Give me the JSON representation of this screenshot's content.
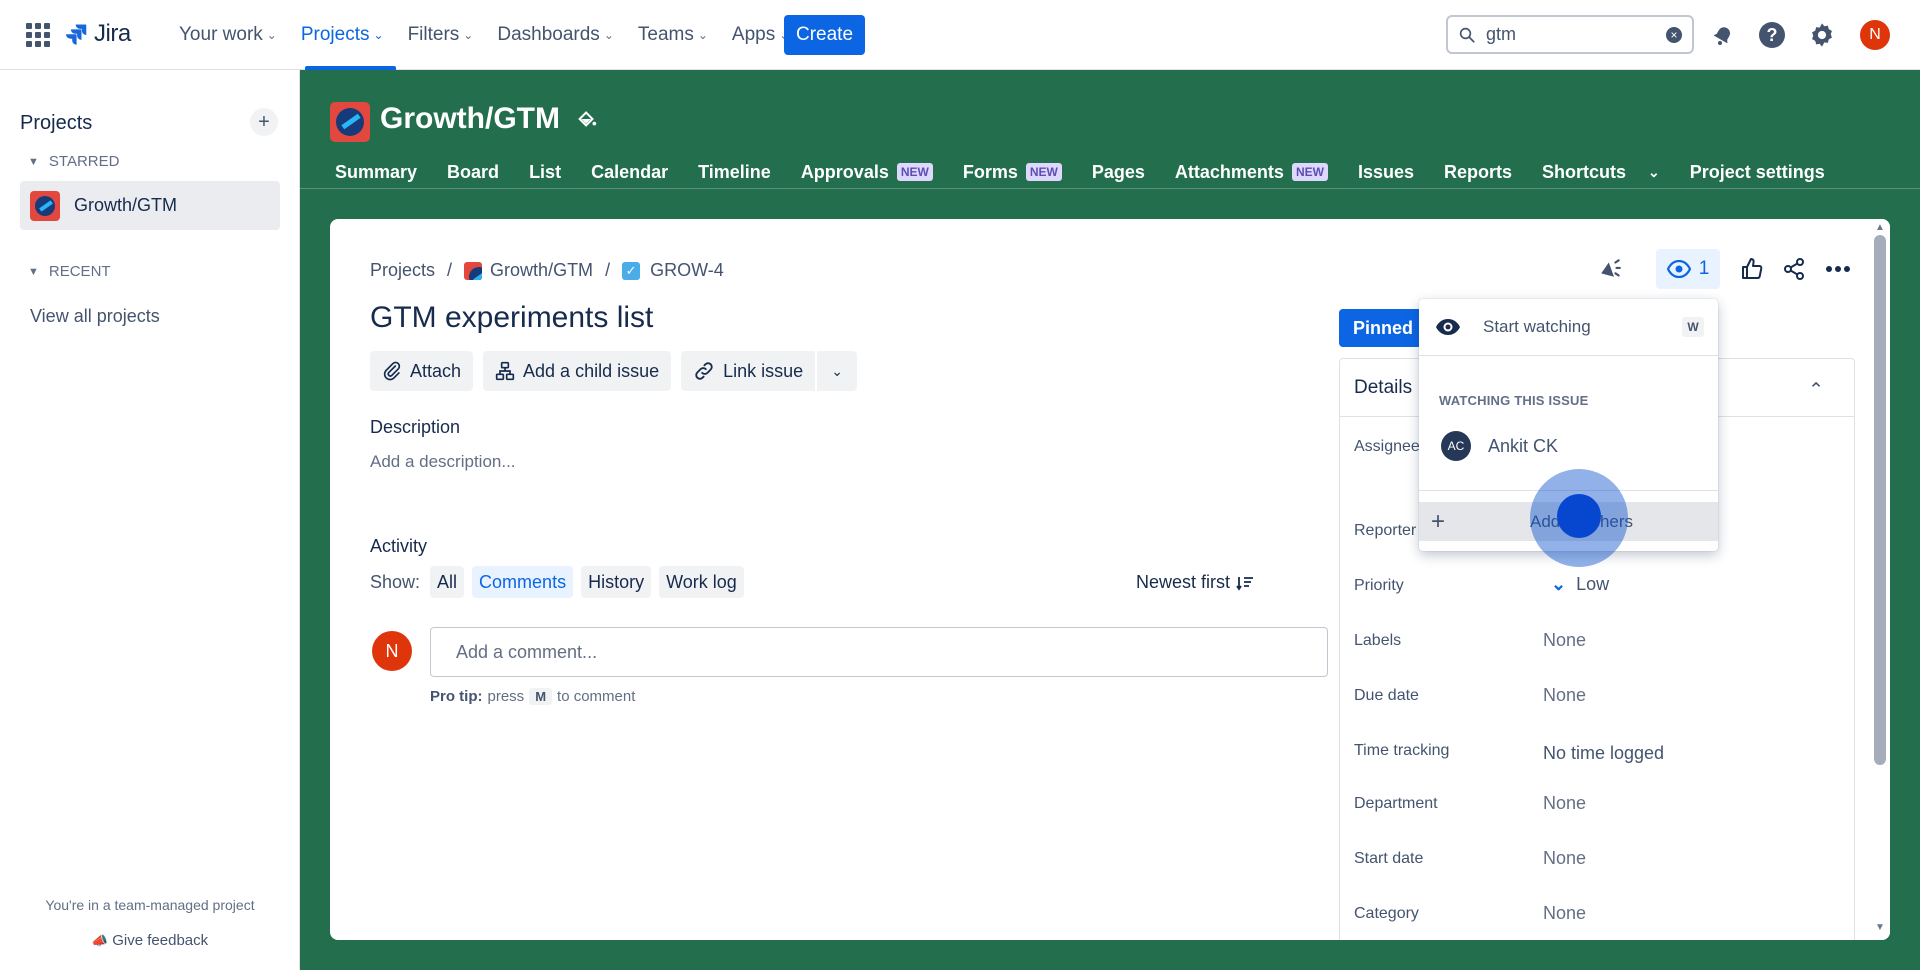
{
  "topnav": {
    "logo_text": "Jira",
    "items": [
      {
        "label": "Your work"
      },
      {
        "label": "Projects"
      },
      {
        "label": "Filters"
      },
      {
        "label": "Dashboards"
      },
      {
        "label": "Teams"
      },
      {
        "label": "Apps"
      }
    ],
    "active_item": "Projects",
    "create_label": "Create",
    "search_value": "gtm",
    "avatar_initial": "N"
  },
  "sidebar": {
    "title": "Projects",
    "starred_label": "STARRED",
    "starred_project": "Growth/GTM",
    "recent_label": "RECENT",
    "view_all": "View all projects",
    "footer_note": "You're in a team-managed project",
    "feedback": "Give feedback"
  },
  "project": {
    "name": "Growth/GTM",
    "tabs": [
      {
        "label": "Summary",
        "badge": ""
      },
      {
        "label": "Board",
        "badge": ""
      },
      {
        "label": "List",
        "badge": ""
      },
      {
        "label": "Calendar",
        "badge": ""
      },
      {
        "label": "Timeline",
        "badge": ""
      },
      {
        "label": "Approvals",
        "badge": "NEW"
      },
      {
        "label": "Forms",
        "badge": "NEW"
      },
      {
        "label": "Pages",
        "badge": ""
      },
      {
        "label": "Attachments",
        "badge": "NEW"
      },
      {
        "label": "Issues",
        "badge": ""
      },
      {
        "label": "Reports",
        "badge": ""
      },
      {
        "label": "Shortcuts",
        "badge": ""
      },
      {
        "label": "Project settings",
        "badge": ""
      }
    ]
  },
  "issue": {
    "breadcrumb": {
      "root": "Projects",
      "project": "Growth/GTM",
      "key": "GROW-4"
    },
    "title": "GTM experiments list",
    "actions": {
      "attach": "Attach",
      "child": "Add a child issue",
      "link": "Link issue"
    },
    "description_label": "Description",
    "description_placeholder": "Add a description...",
    "activity_label": "Activity",
    "show_label": "Show:",
    "filters": [
      "All",
      "Comments",
      "History",
      "Work log"
    ],
    "selected_filter": "Comments",
    "sort_label": "Newest first",
    "comment_avatar": "N",
    "comment_placeholder": "Add a comment...",
    "protip": {
      "label": "Pro tip:",
      "pre": "press",
      "key": "M",
      "post": "to comment"
    },
    "watch_count": "1",
    "pinned_label": "Pinned",
    "details": {
      "title": "Details",
      "fields": [
        {
          "label": "Assignee",
          "value": ""
        },
        {
          "label": "Reporter",
          "value": ""
        },
        {
          "label": "Priority",
          "value": "Low"
        },
        {
          "label": "Labels",
          "value": "None"
        },
        {
          "label": "Due date",
          "value": "None"
        },
        {
          "label": "Time tracking",
          "value": "No time logged"
        },
        {
          "label": "Department",
          "value": "None"
        },
        {
          "label": "Start date",
          "value": "None"
        },
        {
          "label": "Category",
          "value": "None"
        }
      ]
    }
  },
  "watch_menu": {
    "start_label": "Start watching",
    "start_shortcut": "W",
    "section_label": "WATCHING THIS ISSUE",
    "watchers": [
      {
        "initials": "AC",
        "name": "Ankit CK"
      }
    ],
    "add_label": "Add watchers"
  },
  "colors": {
    "brand_blue": "#0c66e4",
    "project_green": "#226e4d",
    "avatar_red": "#de350b"
  }
}
